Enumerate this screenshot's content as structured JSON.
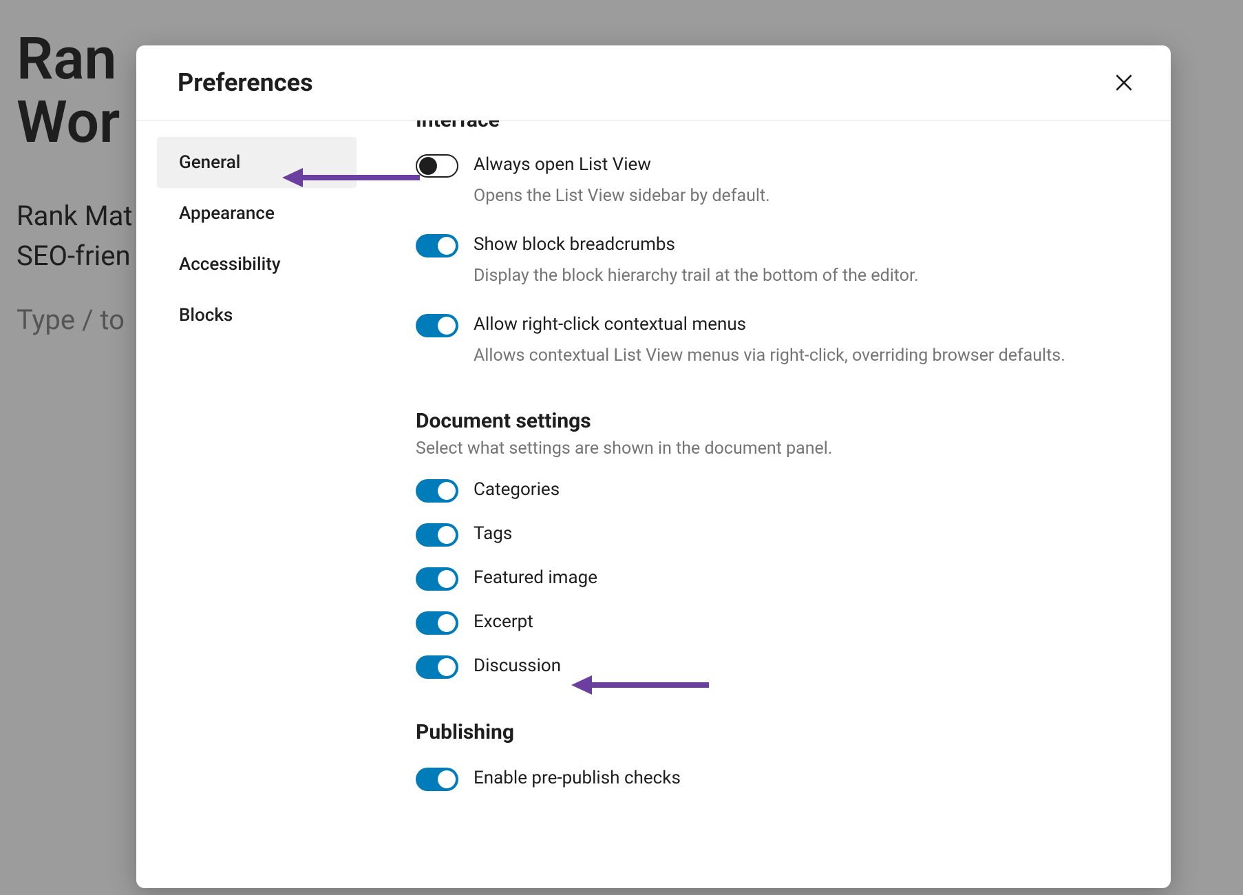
{
  "background": {
    "title_line1": "Ran",
    "title_line2": "Wor",
    "para_line1": "Rank Mat",
    "para_line2": "SEO-frien",
    "placeholder": "Type / to"
  },
  "modal": {
    "title": "Preferences"
  },
  "sidebar": {
    "items": [
      {
        "label": "General",
        "active": true
      },
      {
        "label": "Appearance",
        "active": false
      },
      {
        "label": "Accessibility",
        "active": false
      },
      {
        "label": "Blocks",
        "active": false
      }
    ]
  },
  "sections": {
    "interface": {
      "heading": "Interface",
      "settings": [
        {
          "label": "Always open List View",
          "help": "Opens the List View sidebar by default.",
          "on": false
        },
        {
          "label": "Show block breadcrumbs",
          "help": "Display the block hierarchy trail at the bottom of the editor.",
          "on": true
        },
        {
          "label": "Allow right-click contextual menus",
          "help": "Allows contextual List View menus via right-click, overriding browser defaults.",
          "on": true
        }
      ]
    },
    "document": {
      "heading": "Document settings",
      "desc": "Select what settings are shown in the document panel.",
      "settings": [
        {
          "label": "Categories",
          "on": true
        },
        {
          "label": "Tags",
          "on": true
        },
        {
          "label": "Featured image",
          "on": true
        },
        {
          "label": "Excerpt",
          "on": true
        },
        {
          "label": "Discussion",
          "on": true
        }
      ]
    },
    "publishing": {
      "heading": "Publishing",
      "settings": [
        {
          "label": "Enable pre-publish checks",
          "on": true
        }
      ]
    }
  },
  "colors": {
    "accent": "#007cba",
    "arrow": "#6b3fa0"
  }
}
